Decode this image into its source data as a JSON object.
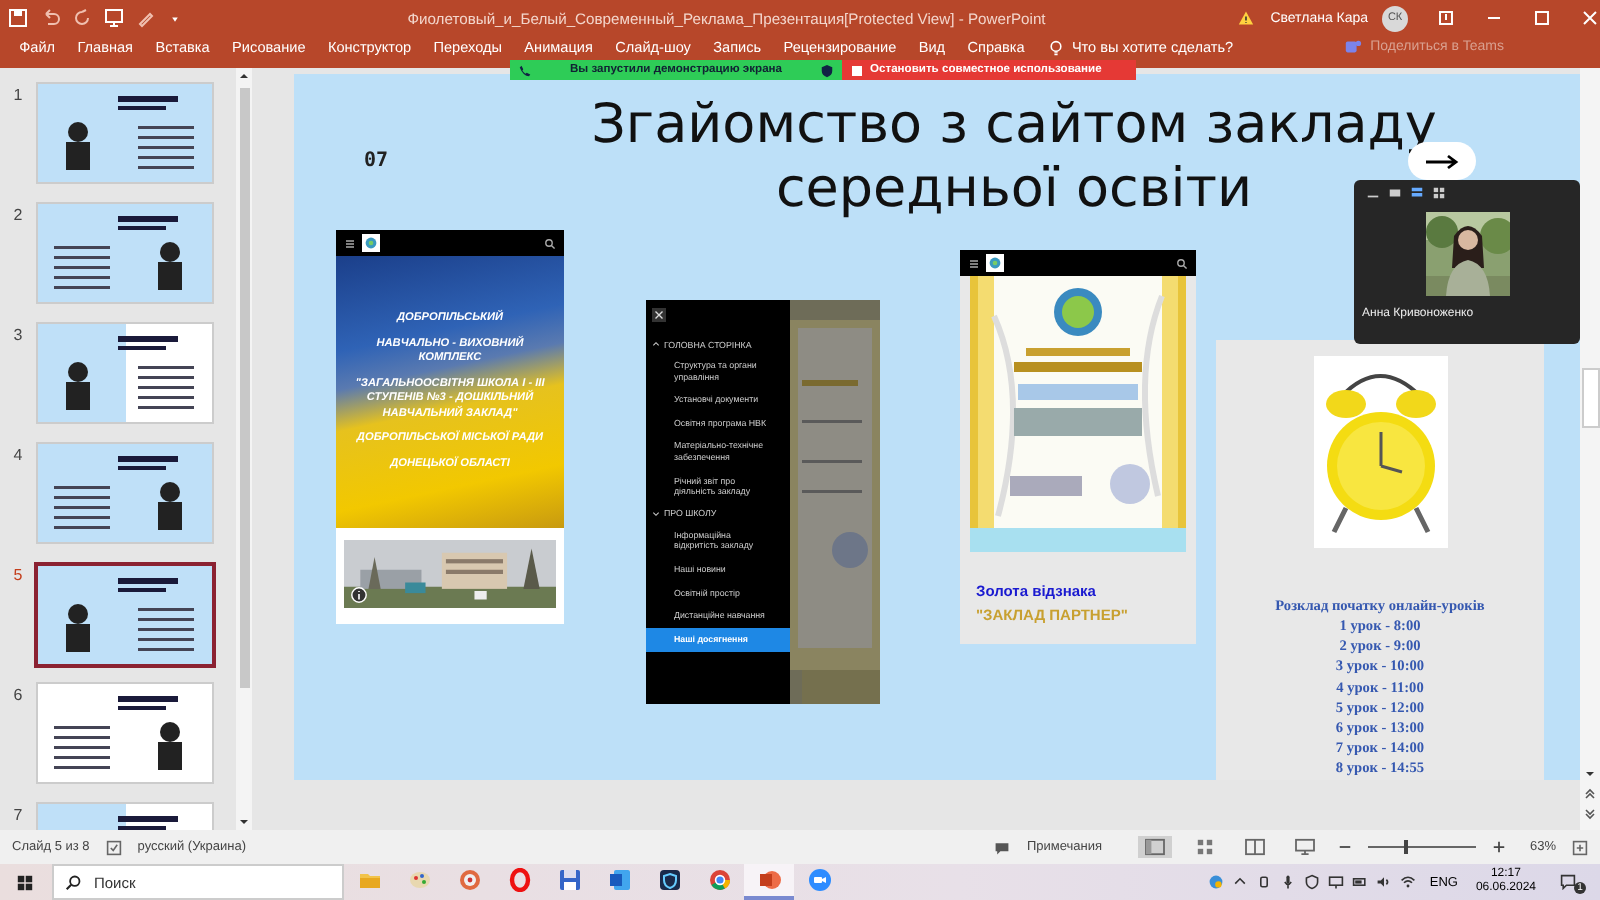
{
  "title_bar": {
    "title": "Фиолетовый_и_Белый_Современный_Реклама_Презентация[Protected View]  -  PowerPoint",
    "user": "Светлана Кара",
    "avatar": "СК"
  },
  "ribbon": {
    "tabs": [
      {
        "label": "Файл",
        "selected": false
      },
      {
        "label": "Главная",
        "selected": false
      },
      {
        "label": "Вставка",
        "selected": false
      },
      {
        "label": "Рисование",
        "selected": false
      },
      {
        "label": "Конструктор",
        "selected": false
      },
      {
        "label": "Переходы",
        "selected": false
      },
      {
        "label": "Анимация",
        "selected": false
      },
      {
        "label": "Слайд-шоу",
        "selected": false
      },
      {
        "label": "Запись",
        "selected": false
      },
      {
        "label": "Рецензирование",
        "selected": false
      },
      {
        "label": "Вид",
        "selected": false
      },
      {
        "label": "Справка",
        "selected": false
      }
    ],
    "search_hint": "Что вы хотите сделать?",
    "teams": "Поделиться в Teams"
  },
  "share_banner": {
    "status": "Вы запустили демонстрацию экрана",
    "stop": "Остановить совместное использование"
  },
  "thumbnails": [
    {
      "number": "1",
      "selected": false
    },
    {
      "number": "2",
      "selected": false
    },
    {
      "number": "3",
      "selected": false
    },
    {
      "number": "4",
      "selected": false
    },
    {
      "number": "5",
      "selected": true
    },
    {
      "number": "6",
      "selected": false
    },
    {
      "number": "7",
      "selected": false
    }
  ],
  "slide": {
    "number": "07",
    "title": [
      "Згайомство з сайтом закладу",
      "середньої освіти"
    ],
    "site_1": {
      "lines": [
        "ДОБРОПІЛЬСЬКИЙ",
        "НАВЧАЛЬНО - ВИХОВНИЙ КОМПЛЕКС",
        "\"ЗАГАЛЬНООСВІТНЯ ШКОЛА І - ІІІ СТУПЕНІВ №3 - ДОШКІЛЬНИЙ НАВЧАЛЬНИЙ ЗАКЛАД\"",
        "ДОБРОПІЛЬСЬКОЇ МІСЬКОЇ РАДИ",
        "ДОНЕЦЬКОЇ ОБЛАСТІ"
      ]
    },
    "site_menu": {
      "items": [
        {
          "kind": "section",
          "label": "ГОЛОВНА СТОРІНКА",
          "expanded": false,
          "selected": false
        },
        {
          "kind": "item",
          "label": "Структура та органи управління",
          "selected": false
        },
        {
          "kind": "item",
          "label": "Установчі документи",
          "selected": false
        },
        {
          "kind": "item",
          "label": "Освітня програма НВК",
          "selected": false
        },
        {
          "kind": "item",
          "label": "Матеріально-технічне забезпечення",
          "selected": false
        },
        {
          "kind": "item",
          "label": "Річний звіт про діяльність закладу",
          "selected": false
        },
        {
          "kind": "section",
          "label": "ПРО ШКОЛУ",
          "expanded": true,
          "selected": false
        },
        {
          "kind": "item",
          "label": "Інформаційна відкритість закладу",
          "selected": false
        },
        {
          "kind": "item",
          "label": "Наші новини",
          "selected": false
        },
        {
          "kind": "item",
          "label": "Освітній простір",
          "selected": false
        },
        {
          "kind": "item",
          "label": "Дистанційне навчання",
          "selected": false
        },
        {
          "kind": "item",
          "label": "Наші досягнення",
          "selected": true
        }
      ]
    },
    "award": {
      "caption": "Золота відзнака",
      "subcaption": "\"ЗАКЛАД ПАРТНЕР\""
    },
    "schedule": {
      "heading": "Розклад початку онлайн-уроків",
      "lessons": [
        "1 урок - 8:00",
        "2 урок - 9:00",
        "3 урок - 10:00",
        "4 урок - 11:00",
        "5 урок - 12:00",
        "6 урок - 13:00",
        "7 урок - 14:00",
        "8 урок - 14:55"
      ]
    }
  },
  "video": {
    "name": "Анна Кривоноженко"
  },
  "status_bar": {
    "slide": "Слайд 5 из 8",
    "language": "русский (Украина)",
    "notes": "Примечания",
    "zoom": {
      "level": 0.35
    },
    "zoom_percent": "63%"
  },
  "taskbar": {
    "search_placeholder": "Поиск",
    "apps": [
      {
        "kind": "folder",
        "selected": false
      },
      {
        "kind": "palette",
        "selected": false
      },
      {
        "kind": "disc",
        "selected": false
      },
      {
        "kind": "ring",
        "selected": false
      },
      {
        "kind": "floppy",
        "selected": false
      },
      {
        "kind": "document",
        "selected": false
      },
      {
        "kind": "shield",
        "selected": false
      },
      {
        "kind": "browser",
        "selected": false
      },
      {
        "kind": "slides",
        "selected": true
      },
      {
        "kind": "camera",
        "selected": false
      }
    ],
    "language": "ENG",
    "time": "12:17",
    "date": "06.06.2024",
    "notifications": "1"
  }
}
